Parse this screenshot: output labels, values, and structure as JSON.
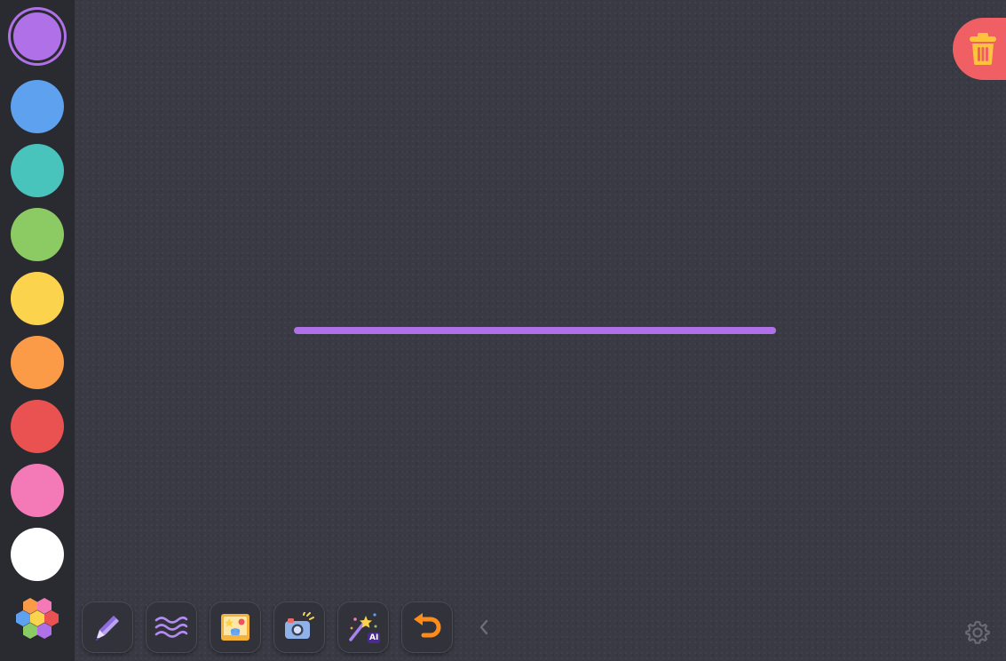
{
  "palette": {
    "selected_color": "#b070e8",
    "colors": [
      {
        "name": "purple",
        "hex": "#b070e8"
      },
      {
        "name": "blue",
        "hex": "#5ea1ee"
      },
      {
        "name": "teal",
        "hex": "#48c4bc"
      },
      {
        "name": "green",
        "hex": "#8cca63"
      },
      {
        "name": "yellow",
        "hex": "#fcd34d"
      },
      {
        "name": "orange",
        "hex": "#fb9b48"
      },
      {
        "name": "red",
        "hex": "#ea5252"
      },
      {
        "name": "pink",
        "hex": "#f47ab7"
      },
      {
        "name": "white",
        "hex": "#ffffff"
      }
    ],
    "more_colors_icon": "hexagon-palette-icon"
  },
  "toolbar": {
    "tools": [
      {
        "name": "pen-tool",
        "icon": "pen-icon"
      },
      {
        "name": "brush-style-tool",
        "icon": "waves-icon"
      },
      {
        "name": "sticker-tool",
        "icon": "picture-icon"
      },
      {
        "name": "camera-tool",
        "icon": "camera-icon"
      },
      {
        "name": "ai-magic-tool",
        "icon": "magic-wand-icon",
        "badge": "AI"
      },
      {
        "name": "undo-tool",
        "icon": "undo-icon"
      }
    ],
    "collapse_icon": "chevron-left-icon"
  },
  "canvas": {
    "stroke_color": "#b070e8"
  },
  "trash": {
    "icon": "trash-icon",
    "color": "#ef5f63"
  },
  "settings": {
    "icon": "gear-icon"
  }
}
